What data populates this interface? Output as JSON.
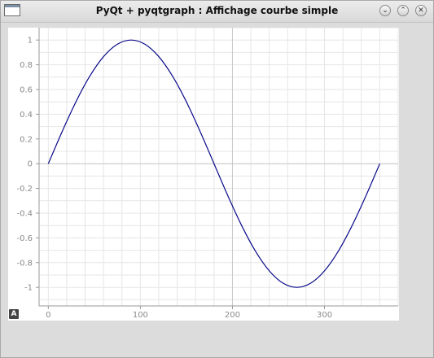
{
  "window": {
    "title": "PyQt + pyqtgraph : Affichage courbe simple",
    "buttons": {
      "minimize_glyph": "⌄",
      "maximize_glyph": "⌃",
      "close_glyph": "✕"
    }
  },
  "plot": {
    "auto_range_label": "A"
  },
  "colors": {
    "curve": "#0a0a8a",
    "grid": "#e6e6e6",
    "axis": "#9a9a9a",
    "tick_text": "#8a8a8a",
    "background": "#ffffff"
  },
  "chart_data": {
    "type": "line",
    "title": "",
    "xlabel": "",
    "ylabel": "",
    "xlim": [
      -10,
      380
    ],
    "ylim": [
      -1.15,
      1.1
    ],
    "x_ticks": [
      0,
      100,
      200,
      300
    ],
    "y_ticks": [
      1,
      0.8,
      0.6,
      0.4,
      0.2,
      0,
      -0.2,
      -0.4,
      -0.6,
      -0.8,
      -1
    ],
    "x_tick_labels": [
      "0",
      "100",
      "200",
      "300"
    ],
    "y_tick_labels": [
      "1",
      "0.8",
      "0.6",
      "0.4",
      "0.2",
      "0",
      "-0.2",
      "-0.4",
      "-0.6",
      "-0.8",
      "-1"
    ],
    "grid": true,
    "series": [
      {
        "x": [
          0,
          15,
          30,
          45,
          60,
          75,
          90,
          105,
          120,
          135,
          150,
          165,
          180,
          195,
          210,
          225,
          240,
          255,
          270,
          285,
          300,
          315,
          330,
          345,
          360
        ],
        "y": [
          0,
          0.259,
          0.5,
          0.707,
          0.866,
          0.966,
          1,
          0.966,
          0.866,
          0.707,
          0.5,
          0.259,
          0,
          -0.259,
          -0.5,
          -0.707,
          -0.866,
          -0.966,
          -1,
          -0.966,
          -0.866,
          -0.707,
          -0.5,
          -0.259,
          0
        ]
      }
    ]
  }
}
